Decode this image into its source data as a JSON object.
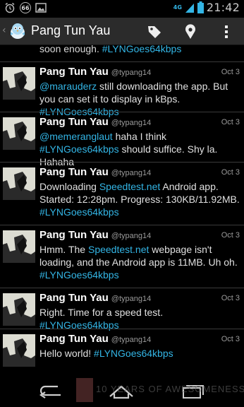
{
  "status_bar": {
    "time": "21:42",
    "badge": "66",
    "signal": "4G",
    "icons": [
      "alarm-icon",
      "badge-66",
      "image-icon",
      "signal-icon",
      "battery-icon"
    ]
  },
  "action_bar": {
    "title": "Pang Tun Yau",
    "icons": [
      "tag-icon",
      "location-icon",
      "overflow-menu-icon"
    ]
  },
  "feed": {
    "partial_prefix": "soon enough. ",
    "partial_tag": "#LYNGoes64kbps",
    "tweets": [
      {
        "name": "Pang Tun Yau",
        "handle": "@typang14",
        "date": "Oct 3",
        "mention": "@marauderz",
        "text": " still downloading the app. But you can set it to display in kBps. ",
        "tag": "#LYNGoes64kbps"
      },
      {
        "name": "Pang Tun Yau",
        "handle": "@typang14",
        "date": "Oct 3",
        "mention": "@memeranglaut",
        "text1": " haha I think ",
        "tag": "#LYNGoes64kbps",
        "text2": " should suffice. Shy la. Hahaha"
      },
      {
        "name": "Pang Tun Yau",
        "handle": "@typang14",
        "date": "Oct 3",
        "text1": "Downloading ",
        "link": "Speedtest.net",
        "text2": " Android app. Started: 12:28pm. Progress: 130KB/11.92MB. ",
        "tag": "#LYNGoes64kbps"
      },
      {
        "name": "Pang Tun Yau",
        "handle": "@typang14",
        "date": "Oct 3",
        "text1": "Hmm. The ",
        "link": "Speedtest.net",
        "text2": " webpage isn't loading, and the Android app is 11MB. Uh oh. ",
        "tag": "#LYNGoes64kbps"
      },
      {
        "name": "Pang Tun Yau",
        "handle": "@typang14",
        "date": "Oct 3",
        "text": "Right. Time for a speed test. ",
        "tag": "#LYNGoes64kbps"
      },
      {
        "name": "Pang Tun Yau",
        "handle": "@typang14",
        "date": "Oct 3",
        "text": "Hello world! ",
        "tag": "#LYNGoes64kbps"
      }
    ]
  },
  "navigation": {
    "buttons": [
      "back-icon",
      "home-icon",
      "recent-apps-icon"
    ]
  },
  "watermark": "10 YEARS OF AWESOMENESS",
  "colors": {
    "accent": "#33b5e5",
    "action_bar": "#2b2b2b",
    "background": "#000000"
  }
}
